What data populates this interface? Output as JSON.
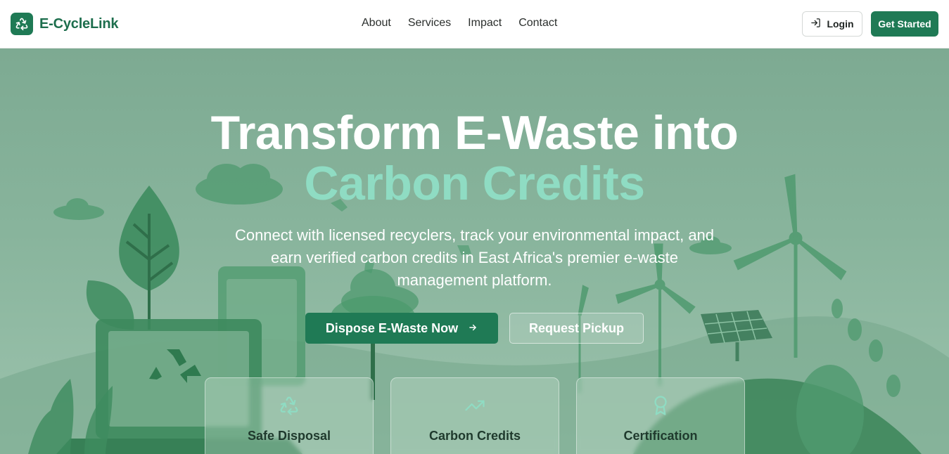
{
  "brand": {
    "name": "E-CycleLink",
    "logo_icon": "recycle-icon"
  },
  "nav": {
    "items": [
      "About",
      "Services",
      "Impact",
      "Contact"
    ]
  },
  "header_actions": {
    "login_label": "Login",
    "login_icon": "login-icon",
    "get_started_label": "Get Started"
  },
  "hero": {
    "title_line1": "Transform E-Waste into",
    "title_line2": "Carbon Credits",
    "subtitle": "Connect with licensed recyclers, track your environmental impact, and earn verified carbon credits in East Africa's premier e-waste management platform.",
    "primary_button": "Dispose E-Waste Now",
    "primary_button_icon": "arrow-right-icon",
    "secondary_button": "Request Pickup"
  },
  "features": [
    {
      "title": "Safe Disposal",
      "icon": "recycle-icon"
    },
    {
      "title": "Carbon Credits",
      "icon": "trending-up-icon"
    },
    {
      "title": "Certification",
      "icon": "award-icon"
    }
  ],
  "colors": {
    "brand_green": "#1f7a55",
    "accent_mint": "#8fdcc3",
    "hero_bg": "#86b29a"
  }
}
